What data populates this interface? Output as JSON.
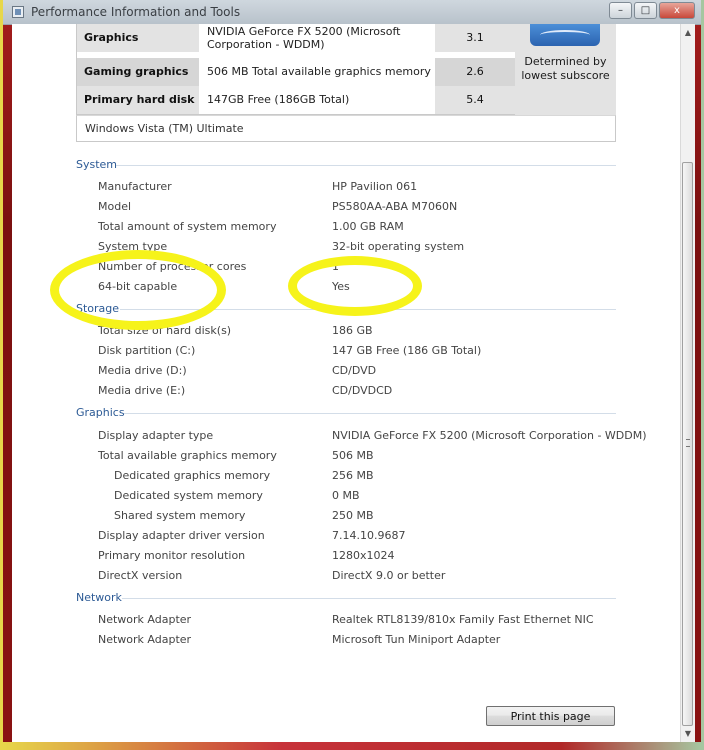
{
  "window": {
    "title": "Performance Information and Tools",
    "controls": {
      "minimize": "–",
      "maximize": "□",
      "close": "x"
    }
  },
  "scores": {
    "rows": [
      {
        "component": "Graphics",
        "details": "NVIDIA GeForce FX 5200 (Microsoft Corporation - WDDM)",
        "subscore": "3.1"
      },
      {
        "component": "Gaming graphics",
        "details": "506 MB Total available graphics memory",
        "subscore": "2.6"
      },
      {
        "component": "Primary hard disk",
        "details": "147GB Free (186GB Total)",
        "subscore": "5.4"
      }
    ],
    "determined_by": "Determined by lowest subscore",
    "os": "Windows Vista (TM) Ultimate"
  },
  "sections": {
    "system": {
      "title": "System",
      "rows": [
        {
          "label": "Manufacturer",
          "value": "HP Pavilion 061"
        },
        {
          "label": "Model",
          "value": "PS580AA-ABA M7060N"
        },
        {
          "label": "Total amount of system memory",
          "value": "1.00 GB RAM"
        },
        {
          "label": "System type",
          "value": "32-bit operating system"
        },
        {
          "label": "Number of processor cores",
          "value": "1"
        },
        {
          "label": "64-bit capable",
          "value": "Yes"
        }
      ]
    },
    "storage": {
      "title": "Storage",
      "rows": [
        {
          "label": "Total size of hard disk(s)",
          "value": "186 GB"
        },
        {
          "label": "Disk partition (C:)",
          "value": "147 GB Free (186 GB Total)"
        },
        {
          "label": "Media drive (D:)",
          "value": "CD/DVD"
        },
        {
          "label": "Media drive (E:)",
          "value": "CD/DVDCD"
        }
      ]
    },
    "graphics": {
      "title": "Graphics",
      "rows": [
        {
          "label": "Display adapter type",
          "value": "NVIDIA GeForce FX 5200 (Microsoft Corporation - WDDM)"
        },
        {
          "label": "Total available graphics memory",
          "value": "506 MB"
        },
        {
          "label": "Dedicated graphics memory",
          "value": "256 MB"
        },
        {
          "label": "Dedicated system memory",
          "value": "0 MB"
        },
        {
          "label": "Shared system memory",
          "value": "250 MB"
        },
        {
          "label": "Display adapter driver version",
          "value": "7.14.10.9687"
        },
        {
          "label": "Primary monitor resolution",
          "value": "1280x1024"
        },
        {
          "label": "DirectX version",
          "value": "DirectX 9.0 or better"
        }
      ]
    },
    "network": {
      "title": "Network",
      "rows": [
        {
          "label": "Network Adapter",
          "value": "Realtek RTL8139/810x Family Fast Ethernet NIC"
        },
        {
          "label": "Network Adapter",
          "value": "Microsoft Tun Miniport Adapter"
        }
      ]
    }
  },
  "actions": {
    "print": "Print this page"
  },
  "colors": {
    "highlight": "#f6f31a",
    "section_heading": "#2c5a95"
  }
}
